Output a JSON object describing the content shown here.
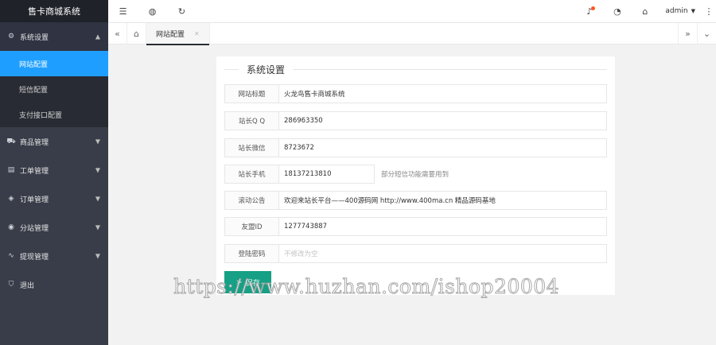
{
  "app_title": "售卡商城系统",
  "sidebar": {
    "system_group": {
      "label": "系统设置",
      "icon": "gear-icon"
    },
    "system_items": [
      {
        "label": "网站配置"
      },
      {
        "label": "短信配置"
      },
      {
        "label": "支付接口配置"
      }
    ],
    "groups": [
      {
        "label": "商品管理",
        "icon": "cart-icon"
      },
      {
        "label": "工单管理",
        "icon": "ticket-icon"
      },
      {
        "label": "订单管理",
        "icon": "order-icon"
      },
      {
        "label": "分站管理",
        "icon": "site-icon"
      },
      {
        "label": "提现管理",
        "icon": "withdraw-icon"
      }
    ],
    "logout": {
      "label": "退出",
      "icon": "logout-icon"
    }
  },
  "header": {
    "user": "admin"
  },
  "tabs": {
    "active": {
      "label": "网站配置"
    }
  },
  "form": {
    "legend": "系统设置",
    "fields": [
      {
        "label": "网站标题",
        "value": "火龙鸟售卡商城系统"
      },
      {
        "label": "站长Q Q",
        "value": "286963350"
      },
      {
        "label": "站长微信",
        "value": "8723672"
      },
      {
        "label": "站长手机",
        "value": "18137213810",
        "aux": "部分短信功能需要用到"
      },
      {
        "label": "滚动公告",
        "value": "欢迎来站长平台——400源码网  http://www.400ma.cn   精品源码基地"
      },
      {
        "label": "友盟ID",
        "value": "1277743887"
      },
      {
        "label": "登陆密码",
        "placeholder": "不修改为空"
      }
    ],
    "save_label": "保存"
  },
  "watermark": "https://www.huzhan.com/ishop20004",
  "colors": {
    "sidebar_bg": "#393d49",
    "logo_bg": "#20222a",
    "active_item": "#1e9fff",
    "save_button": "#16a085",
    "notify_dot": "#ff5722"
  }
}
